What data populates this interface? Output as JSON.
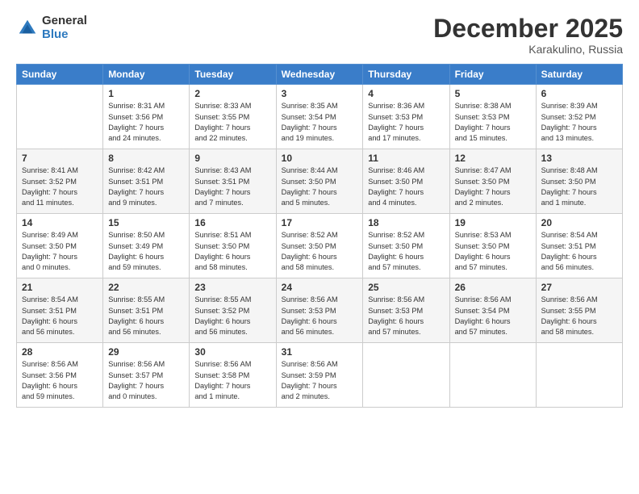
{
  "logo": {
    "general": "General",
    "blue": "Blue"
  },
  "title": "December 2025",
  "subtitle": "Karakulino, Russia",
  "days_header": [
    "Sunday",
    "Monday",
    "Tuesday",
    "Wednesday",
    "Thursday",
    "Friday",
    "Saturday"
  ],
  "weeks": [
    [
      {
        "day": "",
        "info": ""
      },
      {
        "day": "1",
        "info": "Sunrise: 8:31 AM\nSunset: 3:56 PM\nDaylight: 7 hours\nand 24 minutes."
      },
      {
        "day": "2",
        "info": "Sunrise: 8:33 AM\nSunset: 3:55 PM\nDaylight: 7 hours\nand 22 minutes."
      },
      {
        "day": "3",
        "info": "Sunrise: 8:35 AM\nSunset: 3:54 PM\nDaylight: 7 hours\nand 19 minutes."
      },
      {
        "day": "4",
        "info": "Sunrise: 8:36 AM\nSunset: 3:53 PM\nDaylight: 7 hours\nand 17 minutes."
      },
      {
        "day": "5",
        "info": "Sunrise: 8:38 AM\nSunset: 3:53 PM\nDaylight: 7 hours\nand 15 minutes."
      },
      {
        "day": "6",
        "info": "Sunrise: 8:39 AM\nSunset: 3:52 PM\nDaylight: 7 hours\nand 13 minutes."
      }
    ],
    [
      {
        "day": "7",
        "info": "Sunrise: 8:41 AM\nSunset: 3:52 PM\nDaylight: 7 hours\nand 11 minutes."
      },
      {
        "day": "8",
        "info": "Sunrise: 8:42 AM\nSunset: 3:51 PM\nDaylight: 7 hours\nand 9 minutes."
      },
      {
        "day": "9",
        "info": "Sunrise: 8:43 AM\nSunset: 3:51 PM\nDaylight: 7 hours\nand 7 minutes."
      },
      {
        "day": "10",
        "info": "Sunrise: 8:44 AM\nSunset: 3:50 PM\nDaylight: 7 hours\nand 5 minutes."
      },
      {
        "day": "11",
        "info": "Sunrise: 8:46 AM\nSunset: 3:50 PM\nDaylight: 7 hours\nand 4 minutes."
      },
      {
        "day": "12",
        "info": "Sunrise: 8:47 AM\nSunset: 3:50 PM\nDaylight: 7 hours\nand 2 minutes."
      },
      {
        "day": "13",
        "info": "Sunrise: 8:48 AM\nSunset: 3:50 PM\nDaylight: 7 hours\nand 1 minute."
      }
    ],
    [
      {
        "day": "14",
        "info": "Sunrise: 8:49 AM\nSunset: 3:50 PM\nDaylight: 7 hours\nand 0 minutes."
      },
      {
        "day": "15",
        "info": "Sunrise: 8:50 AM\nSunset: 3:49 PM\nDaylight: 6 hours\nand 59 minutes."
      },
      {
        "day": "16",
        "info": "Sunrise: 8:51 AM\nSunset: 3:50 PM\nDaylight: 6 hours\nand 58 minutes."
      },
      {
        "day": "17",
        "info": "Sunrise: 8:52 AM\nSunset: 3:50 PM\nDaylight: 6 hours\nand 58 minutes."
      },
      {
        "day": "18",
        "info": "Sunrise: 8:52 AM\nSunset: 3:50 PM\nDaylight: 6 hours\nand 57 minutes."
      },
      {
        "day": "19",
        "info": "Sunrise: 8:53 AM\nSunset: 3:50 PM\nDaylight: 6 hours\nand 57 minutes."
      },
      {
        "day": "20",
        "info": "Sunrise: 8:54 AM\nSunset: 3:51 PM\nDaylight: 6 hours\nand 56 minutes."
      }
    ],
    [
      {
        "day": "21",
        "info": "Sunrise: 8:54 AM\nSunset: 3:51 PM\nDaylight: 6 hours\nand 56 minutes."
      },
      {
        "day": "22",
        "info": "Sunrise: 8:55 AM\nSunset: 3:51 PM\nDaylight: 6 hours\nand 56 minutes."
      },
      {
        "day": "23",
        "info": "Sunrise: 8:55 AM\nSunset: 3:52 PM\nDaylight: 6 hours\nand 56 minutes."
      },
      {
        "day": "24",
        "info": "Sunrise: 8:56 AM\nSunset: 3:53 PM\nDaylight: 6 hours\nand 56 minutes."
      },
      {
        "day": "25",
        "info": "Sunrise: 8:56 AM\nSunset: 3:53 PM\nDaylight: 6 hours\nand 57 minutes."
      },
      {
        "day": "26",
        "info": "Sunrise: 8:56 AM\nSunset: 3:54 PM\nDaylight: 6 hours\nand 57 minutes."
      },
      {
        "day": "27",
        "info": "Sunrise: 8:56 AM\nSunset: 3:55 PM\nDaylight: 6 hours\nand 58 minutes."
      }
    ],
    [
      {
        "day": "28",
        "info": "Sunrise: 8:56 AM\nSunset: 3:56 PM\nDaylight: 6 hours\nand 59 minutes."
      },
      {
        "day": "29",
        "info": "Sunrise: 8:56 AM\nSunset: 3:57 PM\nDaylight: 7 hours\nand 0 minutes."
      },
      {
        "day": "30",
        "info": "Sunrise: 8:56 AM\nSunset: 3:58 PM\nDaylight: 7 hours\nand 1 minute."
      },
      {
        "day": "31",
        "info": "Sunrise: 8:56 AM\nSunset: 3:59 PM\nDaylight: 7 hours\nand 2 minutes."
      },
      {
        "day": "",
        "info": ""
      },
      {
        "day": "",
        "info": ""
      },
      {
        "day": "",
        "info": ""
      }
    ]
  ]
}
